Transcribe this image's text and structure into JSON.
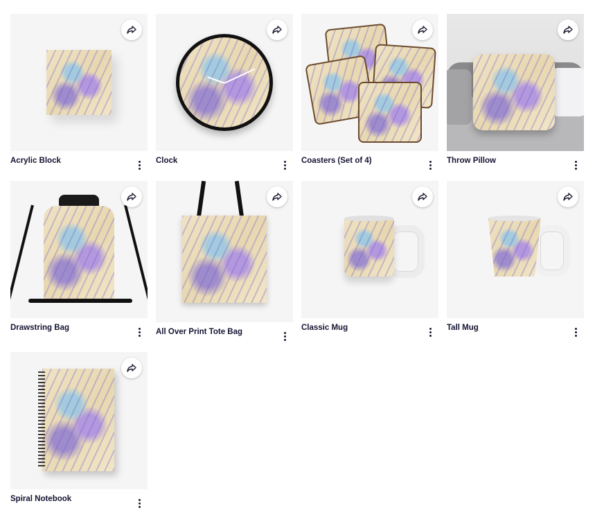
{
  "products": [
    {
      "title": "Acrylic Block",
      "product_icon": "acrylic-block-image"
    },
    {
      "title": "Clock",
      "product_icon": "clock-image"
    },
    {
      "title": "Coasters (Set of 4)",
      "product_icon": "coasters-image"
    },
    {
      "title": "Throw Pillow",
      "product_icon": "throw-pillow-image"
    },
    {
      "title": "Drawstring Bag",
      "product_icon": "drawstring-bag-image"
    },
    {
      "title": "All Over Print Tote Bag",
      "product_icon": "tote-bag-image"
    },
    {
      "title": "Classic Mug",
      "product_icon": "classic-mug-image"
    },
    {
      "title": "Tall Mug",
      "product_icon": "tall-mug-image"
    },
    {
      "title": "Spiral Notebook",
      "product_icon": "spiral-notebook-image"
    }
  ],
  "icons": {
    "share": "share-arrow-icon",
    "more": "more-vertical-icon"
  },
  "colors": {
    "title_text": "#141432",
    "card_bg": "#f5f5f5",
    "page_bg": "#ffffff"
  }
}
